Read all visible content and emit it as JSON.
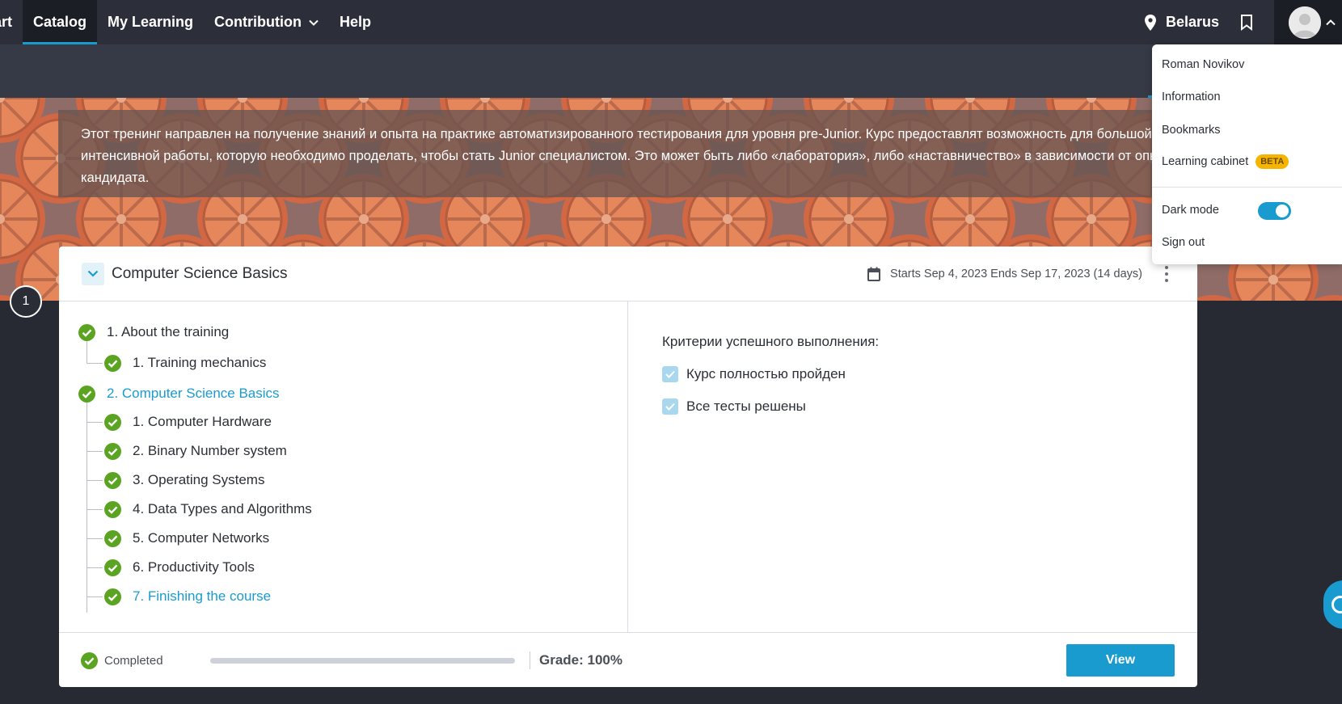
{
  "nav": {
    "items": [
      {
        "label": "tart"
      },
      {
        "label": "Catalog"
      },
      {
        "label": "My Learning"
      },
      {
        "label": "Contribution"
      },
      {
        "label": "Help"
      }
    ],
    "location": "Belarus"
  },
  "banner": {
    "description": "Этот тренинг направлен на получение знаний и опыта на практике автоматизированного тестирования для уровня pre-Junior. Курс предоставлят возможность для большой интенсивной работы, которую необходимо проделать, чтобы стать Junior специалистом. Это может быть либо «лаборатория», либо «наставничество» в зависимости от опыта кандидата."
  },
  "step_number": "1",
  "card": {
    "title": "Computer Science Basics",
    "dates": "Starts Sep 4, 2023 Ends Sep 17, 2023 (14 days)",
    "tree": [
      {
        "label": "1. About the training",
        "level": 0
      },
      {
        "label": "1. Training mechanics",
        "level": 1
      },
      {
        "label": "2. Computer Science Basics",
        "level": 0
      },
      {
        "label": "1. Computer Hardware",
        "level": 1
      },
      {
        "label": "2. Binary Number system",
        "level": 1
      },
      {
        "label": "3. Operating Systems",
        "level": 1
      },
      {
        "label": "4. Data Types and Algorithms",
        "level": 1
      },
      {
        "label": "5. Computer Networks",
        "level": 1
      },
      {
        "label": "6. Productivity Tools",
        "level": 1
      },
      {
        "label": "7. Finishing the course",
        "level": 1
      }
    ],
    "criteria_title": "Критерии успешного выполнения:",
    "criteria": [
      {
        "label": "Курс полностью пройден",
        "checked": true
      },
      {
        "label": "Все тесты решены",
        "checked": true
      }
    ],
    "footer": {
      "status": "Completed",
      "progress_percent": 100,
      "grade": "Grade: 100%",
      "view_label": "View"
    }
  },
  "user_menu": {
    "name": "Roman Novikov",
    "information": "Information",
    "bookmarks": "Bookmarks",
    "learning_cabinet": "Learning cabinet",
    "beta_badge": "BETA",
    "dark_mode": "Dark mode",
    "dark_mode_on": true,
    "sign_out": "Sign out"
  },
  "colors": {
    "accent": "#1a9bd0",
    "success": "#5ba422",
    "nav_bg": "#2c2f39",
    "beta": "#f5b400"
  }
}
